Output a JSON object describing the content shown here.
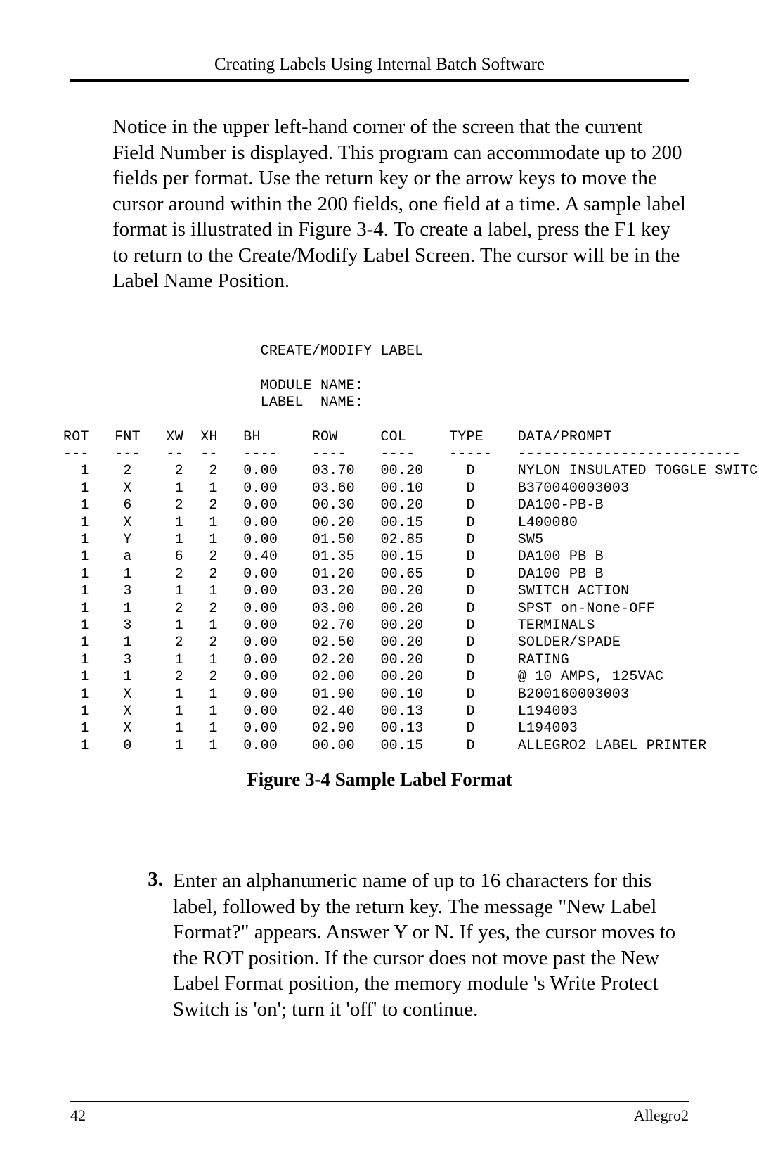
{
  "header": {
    "running_title": "Creating Labels Using Internal Batch Software"
  },
  "intro_paragraph": "Notice in the upper left-hand corner of the screen that the current Field Number is displayed. This program can accommodate up to 200 fields per format. Use the return  key or the arrow keys to move the cursor around within the 200 fields, one field at a time. A sample label format is illustrated in Figure 3-4. To create a label, press the F1 key to return to the Create/Modify Label Screen. The cursor will be in the Label Name Position.",
  "screen": {
    "title": "CREATE/MODIFY LABEL",
    "module_label": "MODULE NAME:",
    "module_blank": "________________",
    "label_label": "LABEL  NAME:",
    "label_blank": "________________",
    "columns": {
      "rot": "ROT",
      "fnt": "FNT",
      "xw": "XW",
      "xh": "XH",
      "bh": "BH",
      "row": "ROW",
      "col": "COL",
      "type": "TYPE",
      "data": "DATA/PROMPT"
    },
    "rule": {
      "rot": "---",
      "fnt": "---",
      "xw": "--",
      "xh": "--",
      "bh": "----",
      "row": "----",
      "col": "----",
      "type": "-----",
      "data": "--------------------------"
    },
    "rows": [
      {
        "rot": "1",
        "fnt": "2",
        "xw": "2",
        "xh": "2",
        "bh": "0.00",
        "row": "03.70",
        "col": "00.20",
        "type": "D",
        "data": "NYLON INSULATED TOGGLE SWITCH"
      },
      {
        "rot": "1",
        "fnt": "X",
        "xw": "1",
        "xh": "1",
        "bh": "0.00",
        "row": "03.60",
        "col": "00.10",
        "type": "D",
        "data": "B370040003003"
      },
      {
        "rot": "1",
        "fnt": "6",
        "xw": "2",
        "xh": "2",
        "bh": "0.00",
        "row": "00.30",
        "col": "00.20",
        "type": "D",
        "data": "DA100-PB-B"
      },
      {
        "rot": "1",
        "fnt": "X",
        "xw": "1",
        "xh": "1",
        "bh": "0.00",
        "row": "00.20",
        "col": "00.15",
        "type": "D",
        "data": "L400080"
      },
      {
        "rot": "1",
        "fnt": "Y",
        "xw": "1",
        "xh": "1",
        "bh": "0.00",
        "row": "01.50",
        "col": "02.85",
        "type": "D",
        "data": "SW5"
      },
      {
        "rot": "1",
        "fnt": "a",
        "xw": "6",
        "xh": "2",
        "bh": "0.40",
        "row": "01.35",
        "col": "00.15",
        "type": "D",
        "data": "DA100 PB B"
      },
      {
        "rot": "1",
        "fnt": "1",
        "xw": "2",
        "xh": "2",
        "bh": "0.00",
        "row": "01.20",
        "col": "00.65",
        "type": "D",
        "data": "DA100 PB B"
      },
      {
        "rot": "1",
        "fnt": "3",
        "xw": "1",
        "xh": "1",
        "bh": "0.00",
        "row": "03.20",
        "col": "00.20",
        "type": "D",
        "data": "SWITCH ACTION"
      },
      {
        "rot": "1",
        "fnt": "1",
        "xw": "2",
        "xh": "2",
        "bh": "0.00",
        "row": "03.00",
        "col": "00.20",
        "type": "D",
        "data": "SPST on-None-OFF"
      },
      {
        "rot": "1",
        "fnt": "3",
        "xw": "1",
        "xh": "1",
        "bh": "0.00",
        "row": "02.70",
        "col": "00.20",
        "type": "D",
        "data": "TERMINALS"
      },
      {
        "rot": "1",
        "fnt": "1",
        "xw": "2",
        "xh": "2",
        "bh": "0.00",
        "row": "02.50",
        "col": "00.20",
        "type": "D",
        "data": "SOLDER/SPADE"
      },
      {
        "rot": "1",
        "fnt": "3",
        "xw": "1",
        "xh": "1",
        "bh": "0.00",
        "row": "02.20",
        "col": "00.20",
        "type": "D",
        "data": "RATING"
      },
      {
        "rot": "1",
        "fnt": "1",
        "xw": "2",
        "xh": "2",
        "bh": "0.00",
        "row": "02.00",
        "col": "00.20",
        "type": "D",
        "data": "@ 10 AMPS, 125VAC"
      },
      {
        "rot": "1",
        "fnt": "X",
        "xw": "1",
        "xh": "1",
        "bh": "0.00",
        "row": "01.90",
        "col": "00.10",
        "type": "D",
        "data": "B200160003003"
      },
      {
        "rot": "1",
        "fnt": "X",
        "xw": "1",
        "xh": "1",
        "bh": "0.00",
        "row": "02.40",
        "col": "00.13",
        "type": "D",
        "data": "L194003"
      },
      {
        "rot": "1",
        "fnt": "X",
        "xw": "1",
        "xh": "1",
        "bh": "0.00",
        "row": "02.90",
        "col": "00.13",
        "type": "D",
        "data": "L194003"
      },
      {
        "rot": "1",
        "fnt": "0",
        "xw": "1",
        "xh": "1",
        "bh": "0.00",
        "row": "00.00",
        "col": "00.15",
        "type": "D",
        "data": "ALLEGRO2 LABEL PRINTER"
      }
    ]
  },
  "figure_caption": "Figure 3-4  Sample Label Format",
  "step": {
    "number": "3.",
    "text": "Enter an alphanumeric name of up to 16 characters for this label, followed by the return  key. The message \"New Label Format?\" appears. Answer Y or N. If yes, the cursor moves to the ROT position. If the cursor does not move past the New Label Format position, the memory module 's Write Protect Switch is 'on'; turn it 'off' to continue."
  },
  "footer": {
    "page_number": "42",
    "product": "Allegro2"
  }
}
